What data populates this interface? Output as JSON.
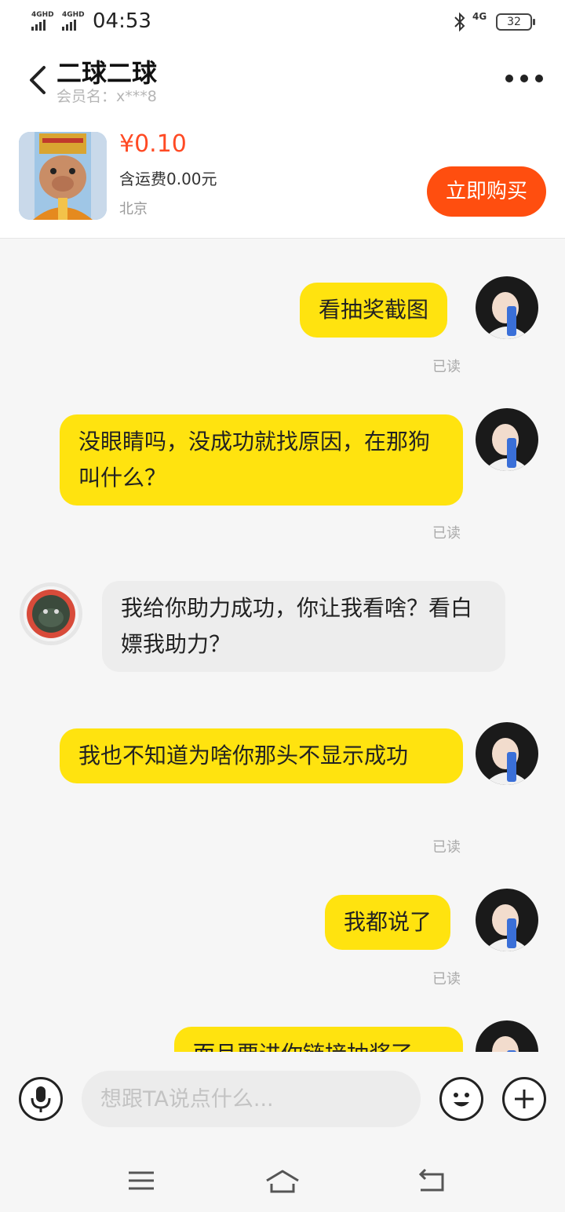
{
  "status_bar": {
    "signal1": "4GHD",
    "signal2": "4GHD",
    "time": "04:53",
    "network": "4G",
    "battery": "32"
  },
  "header": {
    "title": "二球二球",
    "subtitle": "会员名：x***8",
    "back_icon": "chevron-left-icon",
    "more_icon": "more-icon"
  },
  "product": {
    "price": "¥0.10",
    "shipping": "含运费0.00元",
    "location": "北京",
    "buy_label": "立即购买"
  },
  "messages": [
    {
      "sender": "me",
      "text": "看抽奖截图",
      "status": "已读"
    },
    {
      "sender": "me",
      "text": "没眼睛吗，没成功就找原因，在那狗叫什么？",
      "status": "已读"
    },
    {
      "sender": "them",
      "text": "我给你助力成功，你让我看啥？看白嫖我助力？"
    },
    {
      "sender": "me",
      "text": "我也不知道为啥你那头不显示成功",
      "status": "已读"
    },
    {
      "sender": "me",
      "text": "我都说了",
      "status": "已读"
    },
    {
      "sender": "me",
      "text": "而且要进你链接抽奖了"
    }
  ],
  "input": {
    "placeholder": "想跟TA说点什么..."
  },
  "colors": {
    "accent_yellow": "#ffe30f",
    "buy_orange": "#ff4e0f",
    "price_red": "#ff4a24"
  }
}
